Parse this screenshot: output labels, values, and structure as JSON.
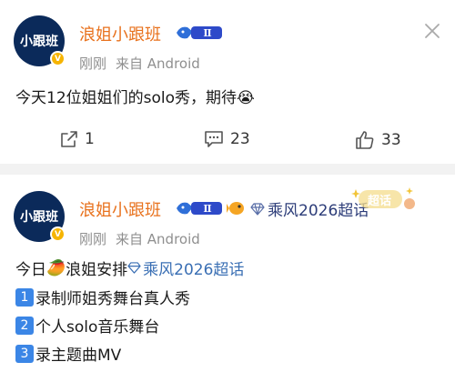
{
  "post1": {
    "avatar_text": "小跟班",
    "verified_badge": "V",
    "username": "浪姐小跟班",
    "membership_level": "Ⅱ",
    "time": "刚刚",
    "source": "来自 Android",
    "text": "今天12位姐姐们的solo秀，期待",
    "emoji": "😭",
    "repost_count": "1",
    "comment_count": "23",
    "like_count": "33"
  },
  "post2": {
    "avatar_text": "小跟班",
    "verified_badge": "V",
    "username": "浪姐小跟班",
    "membership_level": "Ⅱ",
    "topic_badge": "乘风2026超话",
    "super_topic_tag": "超话",
    "time": "刚刚",
    "source": "来自 Android",
    "line1_prefix": "今日",
    "line1_emoji": "🥭",
    "line1_middle": "浪姐安排",
    "line1_topic": "乘风2026超话",
    "items": [
      {
        "num": "1",
        "text": "录制师姐秀舞台真人秀"
      },
      {
        "num": "2",
        "text": "个人solo音乐舞台"
      },
      {
        "num": "3",
        "text": "录主题曲MV"
      }
    ]
  },
  "colors": {
    "username": "#e8711c",
    "topic": "#3a6fb4",
    "meta": "#8f8f8f",
    "background": "#f2f2f2"
  }
}
